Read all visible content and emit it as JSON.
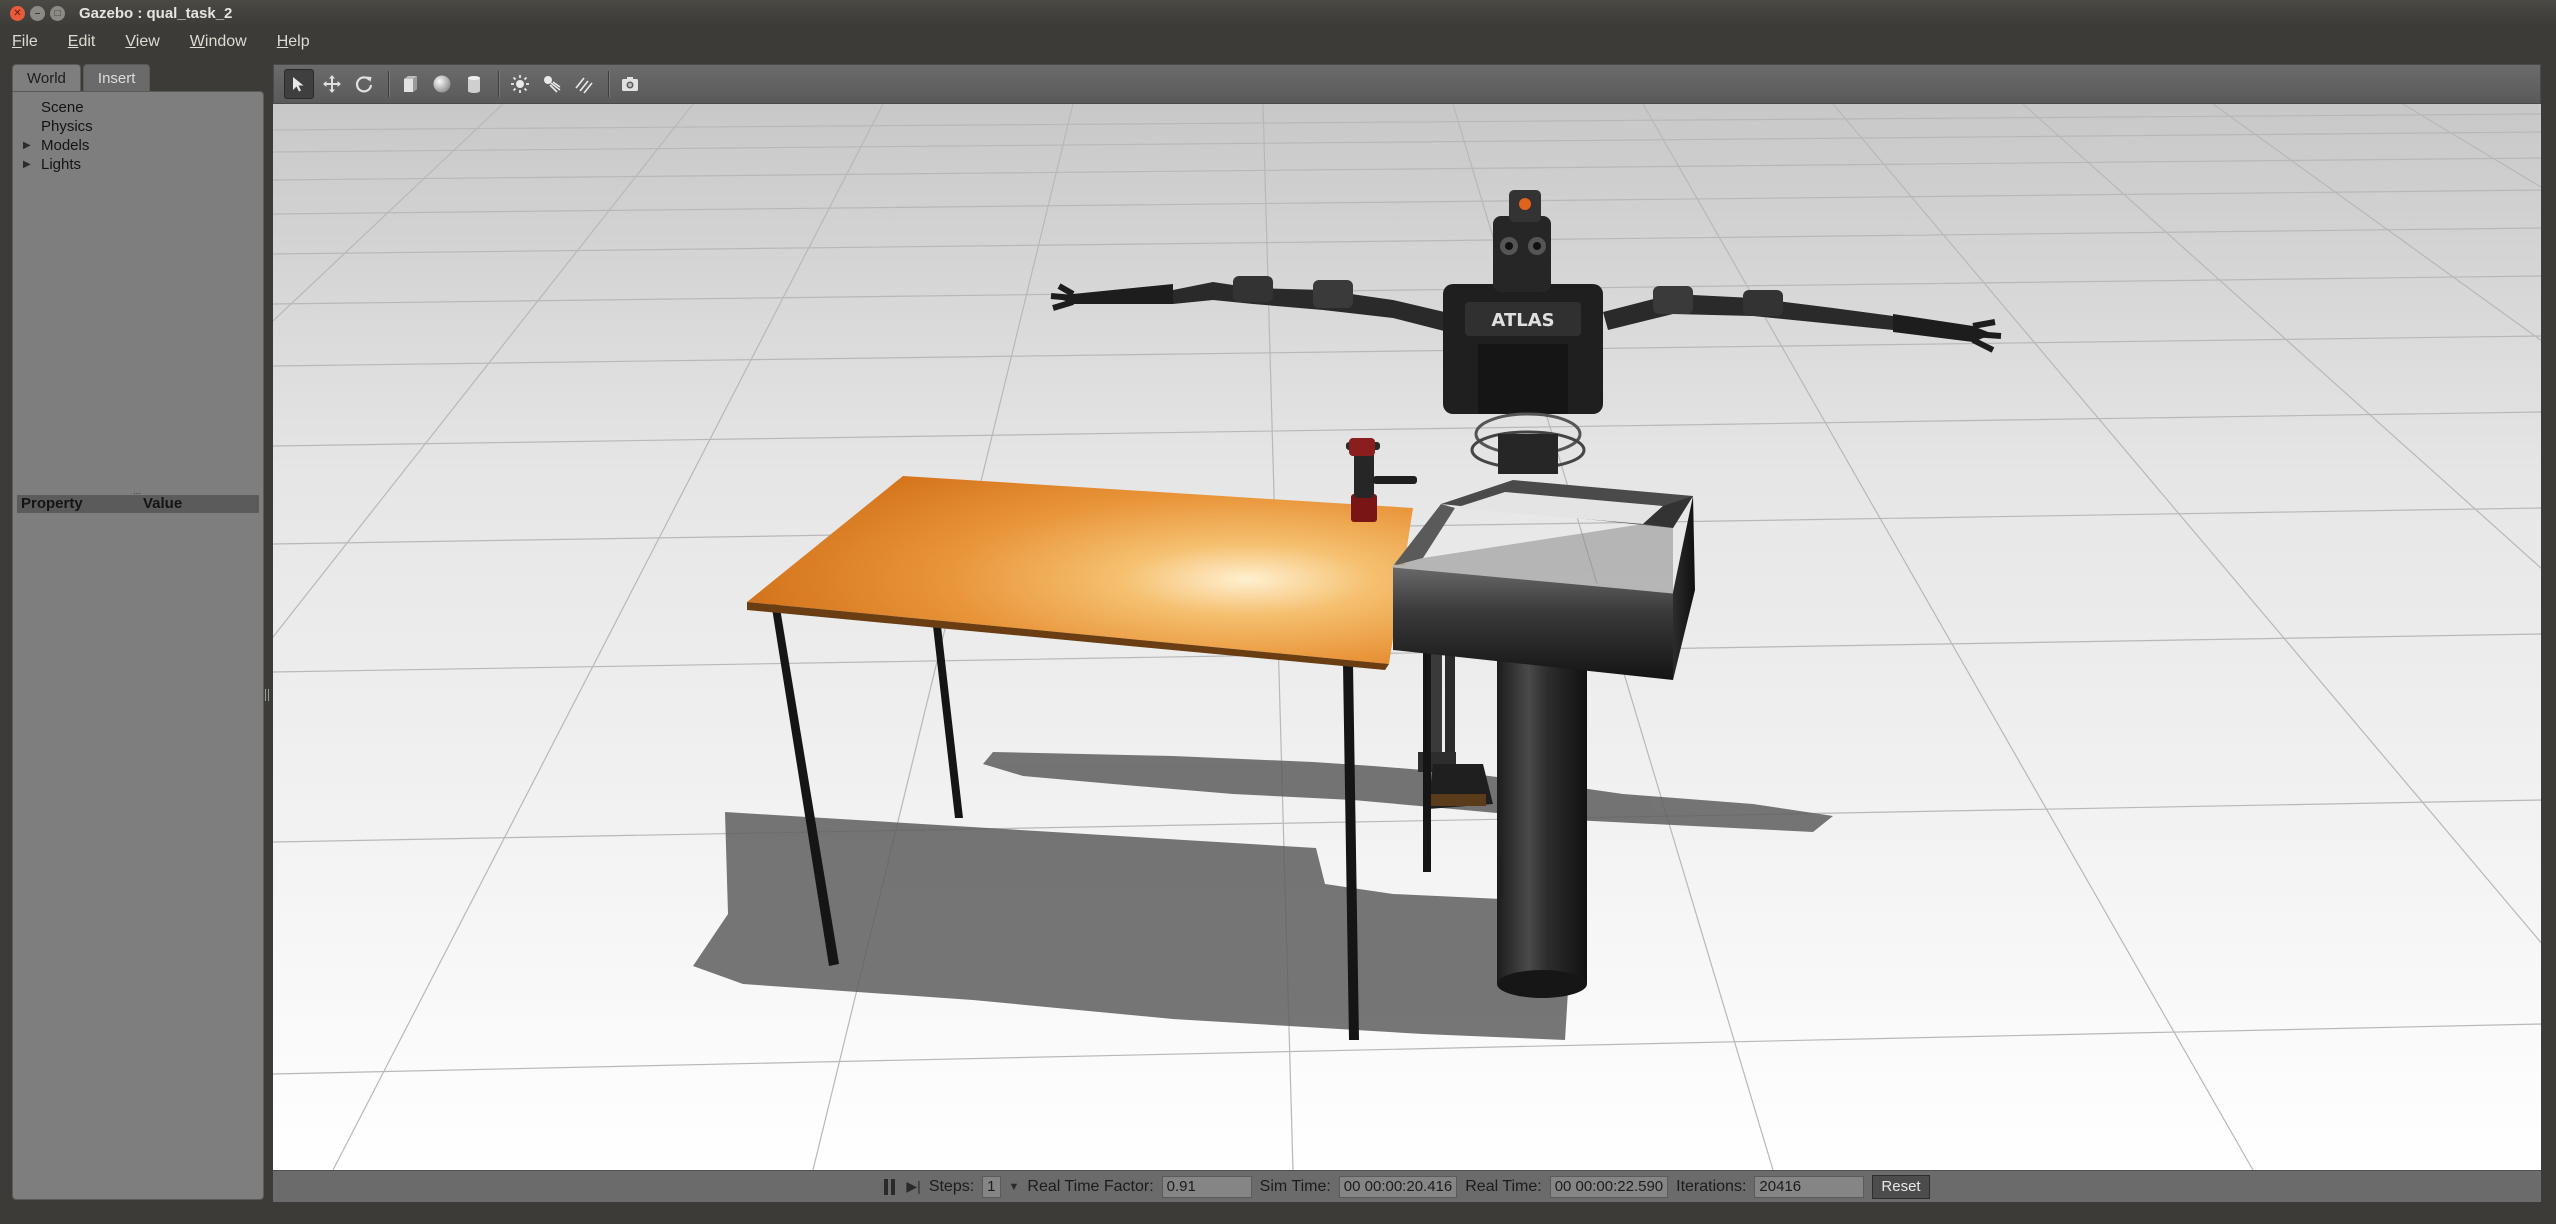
{
  "window": {
    "title": "Gazebo : qual_task_2"
  },
  "menu": {
    "items": [
      {
        "label": "File"
      },
      {
        "label": "Edit"
      },
      {
        "label": "View"
      },
      {
        "label": "Window"
      },
      {
        "label": "Help"
      }
    ]
  },
  "left_panel": {
    "tabs": [
      {
        "label": "World",
        "active": true
      },
      {
        "label": "Insert",
        "active": false
      }
    ],
    "tree": [
      {
        "label": "Scene",
        "expandable": false
      },
      {
        "label": "Physics",
        "expandable": false
      },
      {
        "label": "Models",
        "expandable": true
      },
      {
        "label": "Lights",
        "expandable": true
      }
    ],
    "property_table": {
      "headers": [
        "Property",
        "Value"
      ]
    }
  },
  "toolbar": {
    "tools": [
      {
        "name": "select",
        "icon": "arrow-cursor-icon"
      },
      {
        "name": "translate",
        "icon": "move-arrows-icon"
      },
      {
        "name": "rotate",
        "icon": "rotate-icon"
      },
      {
        "name": "box",
        "icon": "box-icon"
      },
      {
        "name": "sphere",
        "icon": "sphere-icon"
      },
      {
        "name": "cylinder",
        "icon": "cylinder-icon"
      },
      {
        "name": "point-light",
        "icon": "point-light-icon"
      },
      {
        "name": "spot-light",
        "icon": "spot-light-icon"
      },
      {
        "name": "directional-light",
        "icon": "directional-light-icon"
      },
      {
        "name": "screenshot",
        "icon": "camera-icon"
      }
    ]
  },
  "viewport": {
    "robot_chest_label": "ATLAS"
  },
  "bottom_bar": {
    "steps_label": "Steps:",
    "steps_value": "1",
    "rtf_label": "Real Time Factor:",
    "rtf_value": "0.91",
    "sim_time_label": "Sim Time:",
    "sim_time_value": "00 00:00:20.416",
    "real_time_label": "Real Time:",
    "real_time_value": "00 00:00:22.590",
    "iterations_label": "Iterations:",
    "iterations_value": "20416",
    "reset_label": "Reset"
  },
  "colors": {
    "window_bg": "#3c3b37",
    "panel_bg": "#7e7e7e",
    "ground": "#d9d9d9",
    "grid": "#b5b5b5",
    "table_top": "#e99a3b",
    "robot": "#2a2a2a"
  }
}
